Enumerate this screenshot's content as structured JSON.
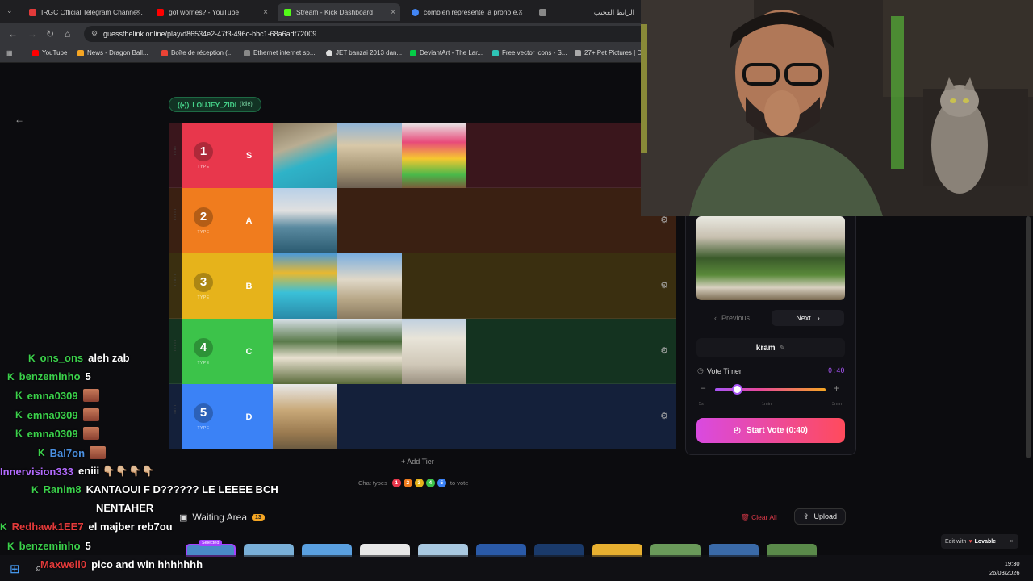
{
  "browser": {
    "tabs": [
      {
        "label": "IRGC Official Telegram Channe...",
        "color": "#e23a3a",
        "active": false
      },
      {
        "label": "got worries? - YouTube",
        "color": "#ff0000",
        "active": false
      },
      {
        "label": "Stream - Kick Dashboard",
        "color": "#53fc18",
        "active": true
      },
      {
        "label": "combien represente la prono e...",
        "color": "#4285f4",
        "active": false
      },
      {
        "label": "الرابط العجيب",
        "color": "#888888",
        "active": false
      }
    ],
    "url": "guessthelink.online/play/d86534e2-47f3-496c-bbc1-68a6adf72009",
    "bookmarks": [
      {
        "label": "YouTube",
        "color": "#ff0000"
      },
      {
        "label": "News - Dragon Ball...",
        "color": "#f6a623"
      },
      {
        "label": "Boîte de réception (...",
        "color": "#ea4335"
      },
      {
        "label": "Ethernet internet sp...",
        "color": "#888888"
      },
      {
        "label": "JET banzai 2013 dan...",
        "color": "#dddddd"
      },
      {
        "label": "DeviantArt - The Lar...",
        "color": "#05cc47"
      },
      {
        "label": "Free vector icons - S...",
        "color": "#2ec4b6"
      },
      {
        "label": "27+ Pet Pictures | D...",
        "color": "#aaaaaa"
      }
    ]
  },
  "game": {
    "streamer": "LOUJEY_ZIDI",
    "streamer_status": "(idle)",
    "tiers": [
      {
        "num": "1",
        "type": "TYPE",
        "letter": "S",
        "color": "#e8374c",
        "row_bg": "#3a161c",
        "images": 3
      },
      {
        "num": "2",
        "type": "TYPE",
        "letter": "A",
        "color": "#f07c1e",
        "row_bg": "#3a2012",
        "images": 1
      },
      {
        "num": "3",
        "type": "TYPE",
        "letter": "B",
        "color": "#e6b31b",
        "row_bg": "#3a2f10",
        "images": 2
      },
      {
        "num": "4",
        "type": "TYPE",
        "letter": "C",
        "color": "#3cc34a",
        "row_bg": "#143320",
        "images": 3
      },
      {
        "num": "5",
        "type": "TYPE",
        "letter": "D",
        "color": "#3b82f6",
        "row_bg": "#14203a",
        "images": 1
      }
    ],
    "add_tier": "Add Tier",
    "chat_types_label": "Chat types",
    "chat_types_suffix": "to vote",
    "chat_type_dots": [
      {
        "label": "1",
        "color": "#e8374c"
      },
      {
        "label": "2",
        "color": "#f07c1e"
      },
      {
        "label": "3",
        "color": "#e6b31b"
      },
      {
        "label": "4",
        "color": "#3cc34a"
      },
      {
        "label": "5",
        "color": "#3b82f6"
      }
    ],
    "waiting_area": "Waiting Area",
    "waiting_count": "13",
    "clear_all": "Clear All",
    "upload": "Upload",
    "selected_tag": "Selected"
  },
  "panel": {
    "previous": "Previous",
    "next": "Next",
    "place_name": "kram",
    "vote_timer_label": "Vote Timer",
    "vote_timer_value": "0:40",
    "timer_level_fraction": 0.2,
    "ticks": [
      "5s",
      "1min",
      "3min"
    ],
    "start_vote": "Start Vote (0:40)"
  },
  "lovable": {
    "prefix": "Edit with",
    "brand": "Lovable"
  },
  "chat": [
    {
      "user": "ons_ons",
      "color": "#3bd14b",
      "msg": "aleh zab",
      "badge": true
    },
    {
      "user": "benzeminho",
      "color": "#3bd14b",
      "msg": "5",
      "badge": true
    },
    {
      "user": "emna0309",
      "color": "#3bd14b",
      "msg": "",
      "badge": true,
      "emote": true
    },
    {
      "user": "emna0309",
      "color": "#3bd14b",
      "msg": "",
      "badge": true,
      "emote": true
    },
    {
      "user": "emna0309",
      "color": "#3bd14b",
      "msg": "",
      "badge": true,
      "emote": true
    },
    {
      "user": "Bal7on",
      "color": "#4a90e2",
      "msg": "",
      "badge": true,
      "emote": true
    },
    {
      "user": "Innervision333",
      "color": "#b36bff",
      "msg": "eniii 👇🏼👇🏼👇🏼👇🏼",
      "badge": false
    },
    {
      "user": "Ranim8",
      "color": "#3bd14b",
      "msg": "KANTAOUI F D?????? LE LEEEE BCH",
      "badge": true
    },
    {
      "user": "",
      "color": "#ffffff",
      "msg": "NENTAHER",
      "badge": false
    },
    {
      "user": "Redhawk1EE7",
      "color": "#e23a3a",
      "msg": "el majber reb7ou",
      "badge": true
    },
    {
      "user": "benzeminho",
      "color": "#3bd14b",
      "msg": "5",
      "badge": true
    },
    {
      "user": "Maxwell0",
      "color": "#e23a3a",
      "msg": "pico and win hhhhhhh",
      "badge": false
    }
  ],
  "clock": {
    "time": "19:30",
    "date": "26/03/2026"
  }
}
